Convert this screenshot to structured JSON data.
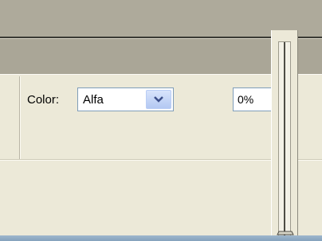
{
  "properties_panel": {
    "color_label": "Color:",
    "color_mode": {
      "selected": "Alfa"
    },
    "alpha_field": {
      "value": "0%"
    }
  },
  "alpha_slider": {
    "value_percent": 0
  },
  "icons": {
    "dropdown": "chevron-down-icon",
    "slider_thumb": "slider-thumb-icon"
  },
  "colors": {
    "panel_bg": "#ece9d8",
    "header_bg": "#aaa697",
    "input_border": "#7f9db9",
    "accent_bottom": "#84a2bd"
  }
}
